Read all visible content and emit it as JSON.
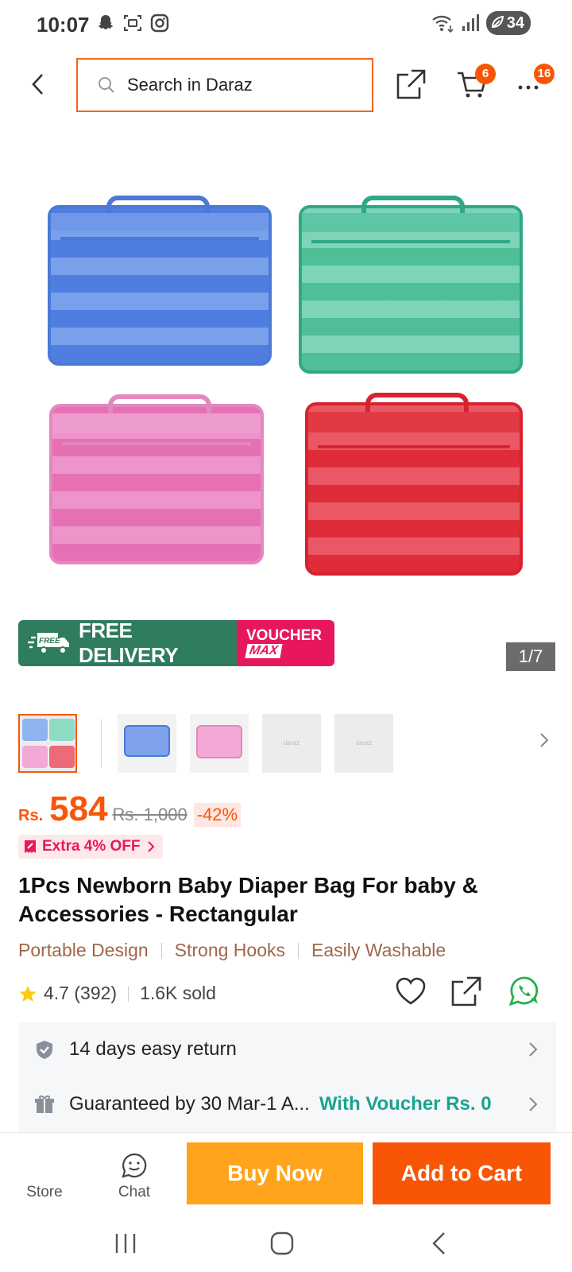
{
  "status_bar": {
    "time": "10:07",
    "battery": "34",
    "left_icons": [
      "snapchat-icon",
      "screenshot-icon",
      "instagram-icon"
    ],
    "right_icons": [
      "wifi-icon",
      "signal-icon",
      "battery-icon"
    ]
  },
  "search": {
    "placeholder": "Search in Daraz"
  },
  "header": {
    "cart_badge": "6",
    "more_badge": "16"
  },
  "product": {
    "image_counter": "1/7",
    "promo": {
      "free_tag": "FREE",
      "free_delivery": "FREE DELIVERY",
      "voucher": "VOUCHER",
      "voucher_max": "MAX"
    },
    "thumbnails": [
      "thumb-1",
      "thumb-2",
      "thumb-3",
      "thumb-4",
      "thumb-5"
    ],
    "thumb_placeholder_text": "daraz",
    "price": {
      "currency": "Rs.",
      "value": "584",
      "original": "Rs. 1,000",
      "discount": "-42%"
    },
    "extra_off": "Extra 4% OFF",
    "title": "1Pcs Newborn Baby Diaper Bag For baby & Accessories - Rectangular",
    "features": [
      "Portable Design",
      "Strong Hooks",
      "Easily Washable"
    ],
    "rating": "4.7 (392)",
    "sold": "1.6K sold"
  },
  "services": {
    "return": "14 days easy return",
    "delivery": "Guaranteed by 30 Mar-1 A...",
    "delivery_voucher": "With Voucher Rs. 0"
  },
  "bottom_bar": {
    "store": "Store",
    "chat": "Chat",
    "buy_now": "Buy Now",
    "add_to_cart": "Add to Cart"
  },
  "colors": {
    "accent": "#f85606",
    "buy_now": "#ffa41c",
    "free_delivery": "#2f7d5e",
    "voucher": "#e8175d",
    "feature_text": "#a0664a",
    "voucher_highlight": "#1aa38f"
  }
}
